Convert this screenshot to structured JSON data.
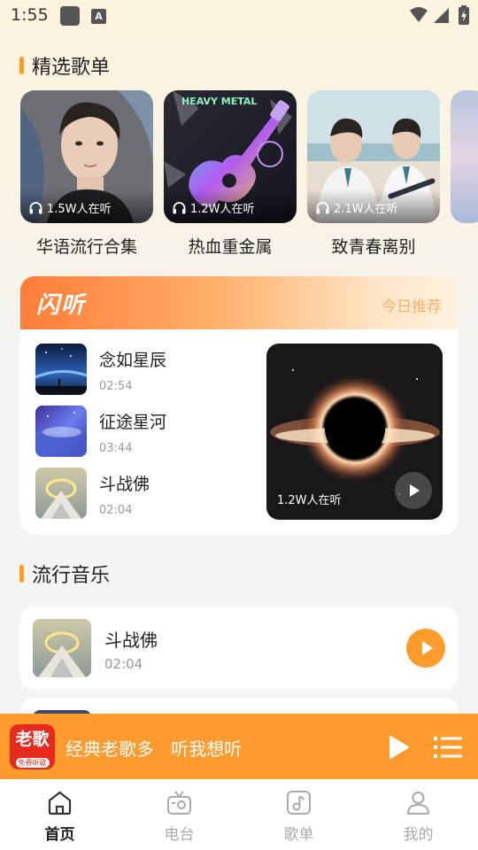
{
  "status_bar": {
    "time": "1:55",
    "notification_badge": "A"
  },
  "sections": {
    "featured_playlists": "精选歌单",
    "pop_music": "流行音乐"
  },
  "playlists": [
    {
      "name": "华语流行合集",
      "listeners": "1.5W人在听",
      "icon": "headphones-icon"
    },
    {
      "name": "热血重金属",
      "listeners": "1.2W人在听",
      "icon": "headphones-icon"
    },
    {
      "name": "致青春离别",
      "listeners": "2.1W人在听",
      "icon": "headphones-icon"
    }
  ],
  "flash_listen": {
    "logo": "闪听",
    "recommend": "今日推荐",
    "songs": [
      {
        "title": "念如星辰",
        "duration": "02:54"
      },
      {
        "title": "征途星河",
        "duration": "03:44"
      },
      {
        "title": "斗战佛",
        "duration": "02:04"
      }
    ],
    "feature_listeners": "1.2W人在听"
  },
  "pop_songs": [
    {
      "title": "斗战佛",
      "duration": "02:04"
    }
  ],
  "mini_player": {
    "logo_main": "老歌",
    "logo_sub": "免费听歌",
    "title": "经典老歌多   听我想听"
  },
  "nav": [
    {
      "label": "首页",
      "icon": "home-icon",
      "active": true
    },
    {
      "label": "电台",
      "icon": "radio-icon",
      "active": false
    },
    {
      "label": "歌单",
      "icon": "music-note-icon",
      "active": false
    },
    {
      "label": "我的",
      "icon": "user-icon",
      "active": false
    }
  ],
  "colors": {
    "accent": "#ff9a2e",
    "section_bar": "#ff9b20",
    "logo_red": "#e62a1e"
  }
}
